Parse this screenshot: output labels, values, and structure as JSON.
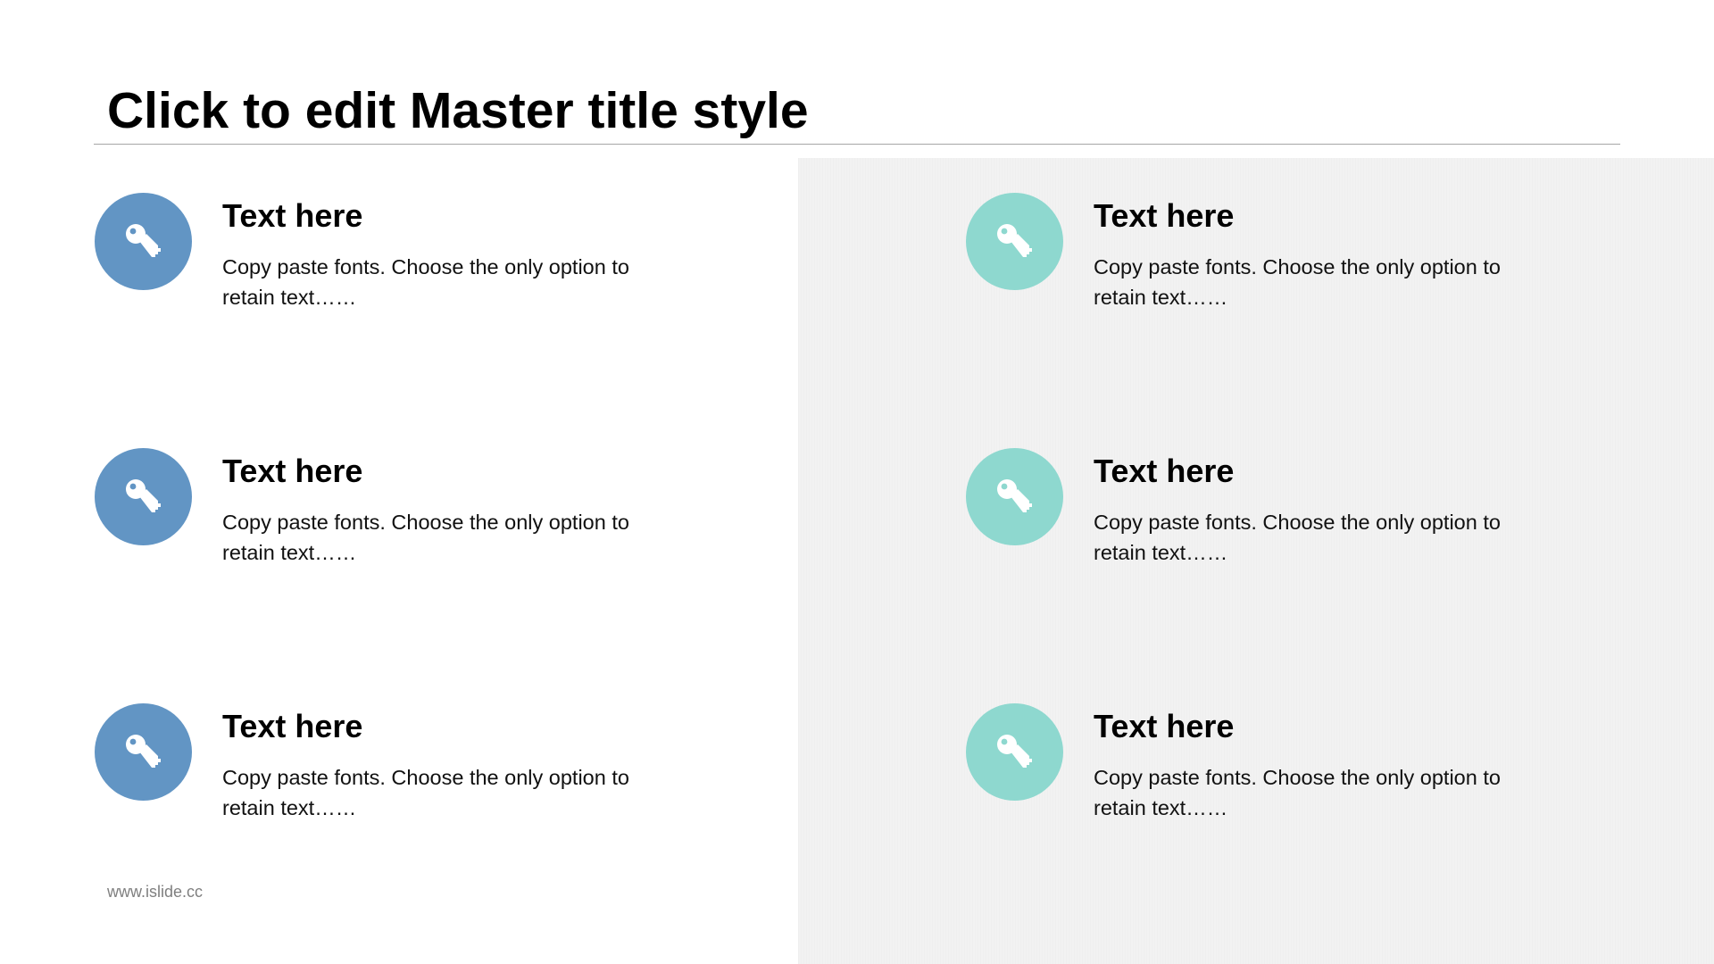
{
  "slide": {
    "title": "Click to edit Master title style",
    "footer": "www.islide.cc"
  },
  "colors": {
    "left_accent": "#6295c4",
    "right_accent": "#8ed8cf",
    "right_panel_bg": "#f2f2f2",
    "rule": "#a6a6a6"
  },
  "items": [
    {
      "column": "left",
      "icon": "key-icon",
      "heading": "Text here",
      "body": "Copy paste fonts. Choose the only option to retain text……"
    },
    {
      "column": "left",
      "icon": "key-icon",
      "heading": "Text here",
      "body": "Copy paste fonts. Choose the only option to retain text……"
    },
    {
      "column": "left",
      "icon": "key-icon",
      "heading": "Text here",
      "body": "Copy paste fonts. Choose the only option to retain text……"
    },
    {
      "column": "right",
      "icon": "key-icon",
      "heading": "Text here",
      "body": "Copy paste fonts. Choose the only option to retain text……"
    },
    {
      "column": "right",
      "icon": "key-icon",
      "heading": "Text here",
      "body": "Copy paste fonts. Choose the only option to retain text……"
    },
    {
      "column": "right",
      "icon": "key-icon",
      "heading": "Text here",
      "body": "Copy paste fonts. Choose the only option to retain text……"
    }
  ]
}
